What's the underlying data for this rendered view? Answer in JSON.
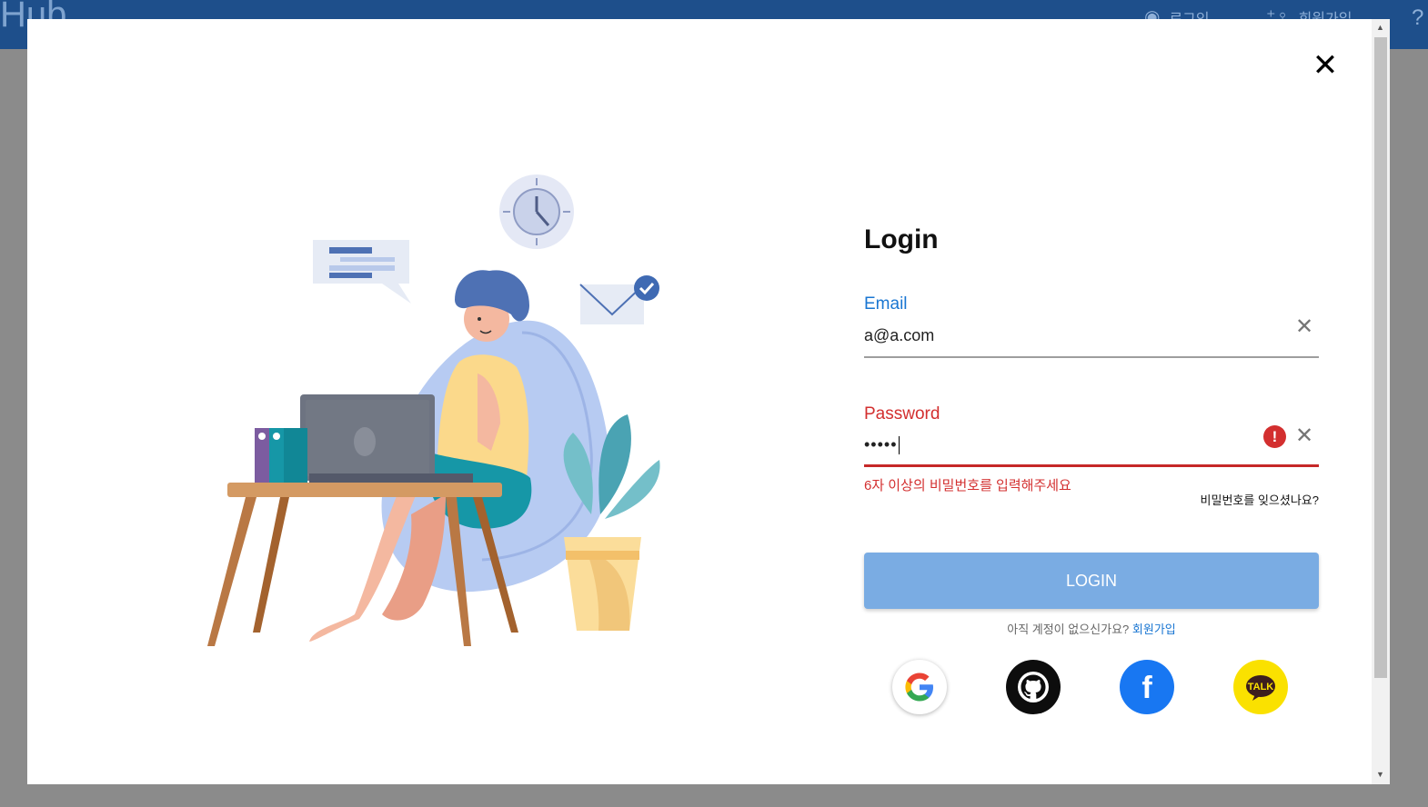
{
  "header": {
    "brand": "Hub",
    "nav": [
      {
        "icon": "user-circle-icon",
        "label": "로그인"
      },
      {
        "icon": "add-user-icon",
        "label": "회원가입"
      }
    ],
    "help_icon": "?"
  },
  "modal": {
    "close_icon": "✕",
    "illustration": "person-working-on-laptop"
  },
  "login": {
    "title": "Login",
    "email": {
      "label": "Email",
      "value": "a@a.com"
    },
    "password": {
      "label": "Password",
      "masked_value": "•••••",
      "error": "6자 이상의 비밀번호를 입력해주세요"
    },
    "forgot_link": "비밀번호를 잊으셨나요?",
    "submit_label": "LOGIN",
    "signup_prompt": "아직 계정이 없으신가요?",
    "signup_link": "회원가입",
    "social": [
      {
        "name": "google",
        "color": "#ffffff"
      },
      {
        "name": "github",
        "color": "#0d0d0d"
      },
      {
        "name": "facebook",
        "color": "#1877f2",
        "glyph": "f"
      },
      {
        "name": "kakao",
        "color": "#fae100",
        "glyph": "TALK"
      }
    ]
  },
  "colors": {
    "accent": "#1976d2",
    "error": "#d32f2f",
    "button": "#7aace3",
    "topbar": "#1e4f8b"
  }
}
